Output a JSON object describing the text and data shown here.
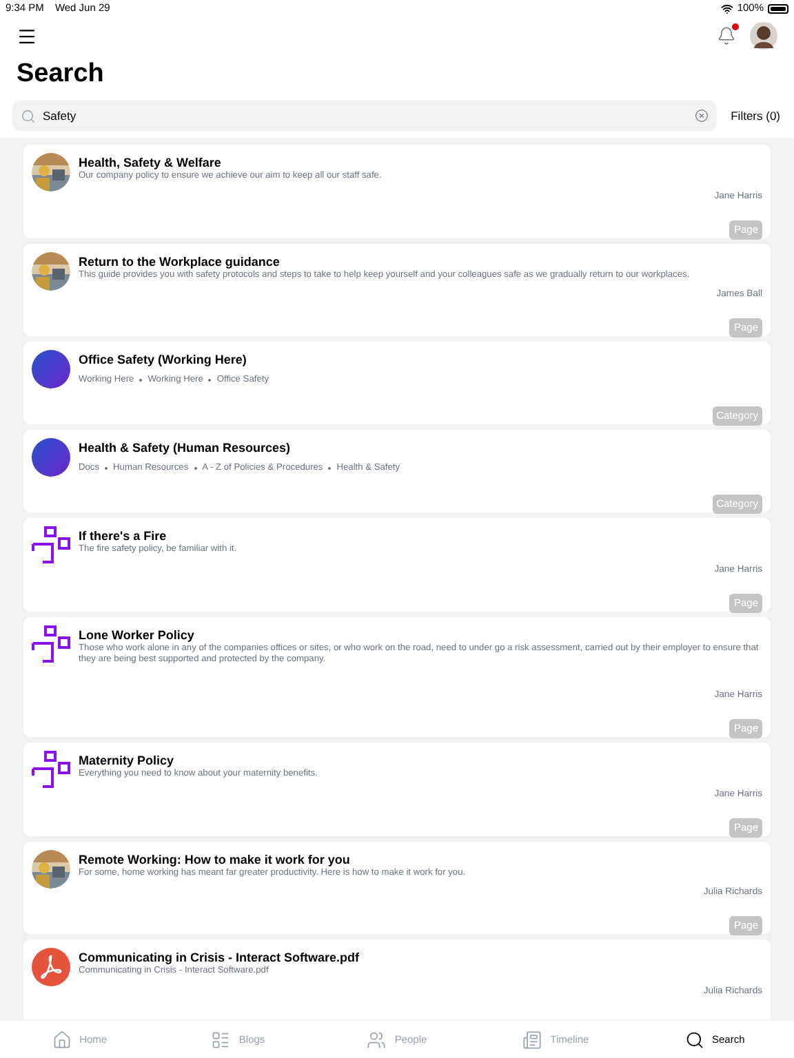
{
  "status_bar": {
    "time": "9:34 PM",
    "date": "Wed Jun 29",
    "battery": "100%"
  },
  "header": {
    "notification_dot": true,
    "title": "Search"
  },
  "search": {
    "value": "Safety",
    "filters": "Filters (0)"
  },
  "results": [
    {
      "title": "Health, Safety & Welfare",
      "description": "Our company policy to ensure we achieve our aim to keep all our staff safe.",
      "author": "Jane Harris",
      "type": "Page"
    },
    {
      "title": "Return to the Workplace guidance",
      "description": "This guide provides you with safety protocols and steps to take to help keep yourself and your colleagues safe as we gradually return to our workplaces.",
      "author": "James Ball",
      "type": "Page"
    },
    {
      "kind": "gradient",
      "title": "Office Safety (Working Here)",
      "breadcrumbs": [
        "Working Here",
        "Working Here",
        "Office Safety"
      ],
      "type": "Category"
    },
    {
      "kind": "gradient",
      "title": "Health & Safety (Human Resources)",
      "breadcrumbs": [
        "Docs",
        "Human Resources",
        "A - Z of Policies & Procedures",
        "Health & Safety"
      ],
      "type": "Category"
    },
    {
      "kind": "logo",
      "title": "If there's a Fire",
      "description": "The fire safety policy, be familiar with it.",
      "author": "Jane Harris",
      "type": "Page"
    },
    {
      "kind": "logo",
      "title": "Lone Worker Policy",
      "description": "Those who work alone in any of the companies offices or sites, or who work on the road, need to under go a risk assessment, carried out by their employer to ensure that they are being best supported and protected by the company.",
      "author": "Jane Harris",
      "type": "Page"
    },
    {
      "kind": "logo",
      "title": "Maternity Policy",
      "description": "Everything you need to know about your maternity benefits.",
      "author": "Jane Harris",
      "type": "Page"
    },
    {
      "title": "Remote Working: How to make it work for you",
      "description": "For some, home working has meant far greater productivity. Here is how to make it work for you.",
      "author": "Julia Richards",
      "type": "Page"
    },
    {
      "kind": "pdf",
      "title": "Communicating in Crisis - Interact Software.pdf",
      "description": "Communicating in Crisis - Interact Software.pdf",
      "author": "Julia Richards"
    }
  ],
  "tab_bar": [
    {
      "kind": "home",
      "label": "Home",
      "selected": false
    },
    {
      "kind": "blogs",
      "label": "Blogs",
      "selected": false
    },
    {
      "kind": "people",
      "label": "People",
      "selected": false
    },
    {
      "kind": "timeline",
      "label": "Timeline",
      "selected": false
    },
    {
      "kind": "search",
      "label": "Search",
      "selected": true
    }
  ]
}
